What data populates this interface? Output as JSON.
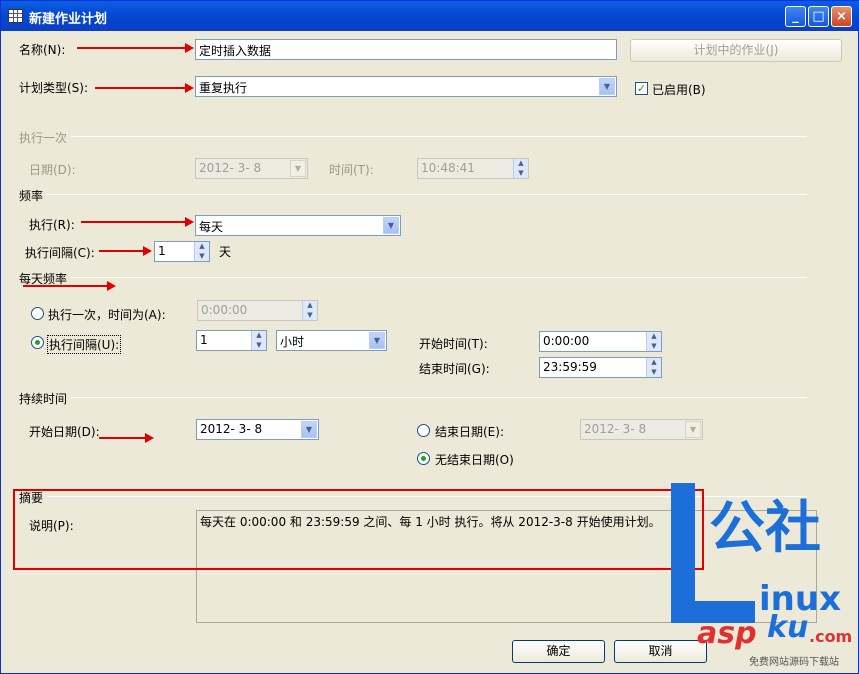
{
  "window": {
    "title": "新建作业计划"
  },
  "name": {
    "label": "名称(N):",
    "value": "定时插入数据",
    "jobs_button": "计划中的作业(J)"
  },
  "schedule_type": {
    "label": "计划类型(S):",
    "value": "重复执行",
    "enabled_label": "已启用(B)",
    "enabled": true
  },
  "run_once": {
    "title": "执行一次",
    "date_label": "日期(D):",
    "date_value": "2012- 3- 8",
    "time_label": "时间(T):",
    "time_value": "10:48:41"
  },
  "frequency": {
    "title": "频率",
    "run_label": "执行(R):",
    "run_value": "每天",
    "interval_label": "执行间隔(C):",
    "interval_value": "1",
    "interval_unit": "天"
  },
  "daily": {
    "title": "每天频率",
    "once_label": "执行一次，时间为(A):",
    "once_value": "0:00:00",
    "once_selected": false,
    "every_label": "执行间隔(U):",
    "every_selected": true,
    "every_value": "1",
    "every_unit": "小时",
    "start_label": "开始时间(T):",
    "start_value": "0:00:00",
    "end_label": "结束时间(G):",
    "end_value": "23:59:59"
  },
  "duration": {
    "title": "持续时间",
    "start_label": "开始日期(D):",
    "start_value": "2012- 3- 8",
    "end_label": "结束日期(E):",
    "end_value": "2012- 3- 8",
    "end_selected": false,
    "no_end_label": "无结束日期(O)",
    "no_end_selected": true
  },
  "summary": {
    "title": "摘要",
    "desc_label": "说明(P):",
    "desc_value": "每天在 0:00:00 和 23:59:59 之间、每 1 小时 执行。将从 2012-3-8 开始使用计划。"
  },
  "buttons": {
    "ok": "确定",
    "cancel": "取消"
  },
  "watermark": {
    "line1": "公社",
    "line2": "inux",
    "line3": "asp",
    "line4": "ku",
    "line5": ".com",
    "footer": "免费网站源码下载站"
  },
  "colors": {
    "title_bar": "#0548d1",
    "dialog_bg": "#ece9d8",
    "annotation": "#e00000",
    "watermark": "#1c6fd8"
  }
}
